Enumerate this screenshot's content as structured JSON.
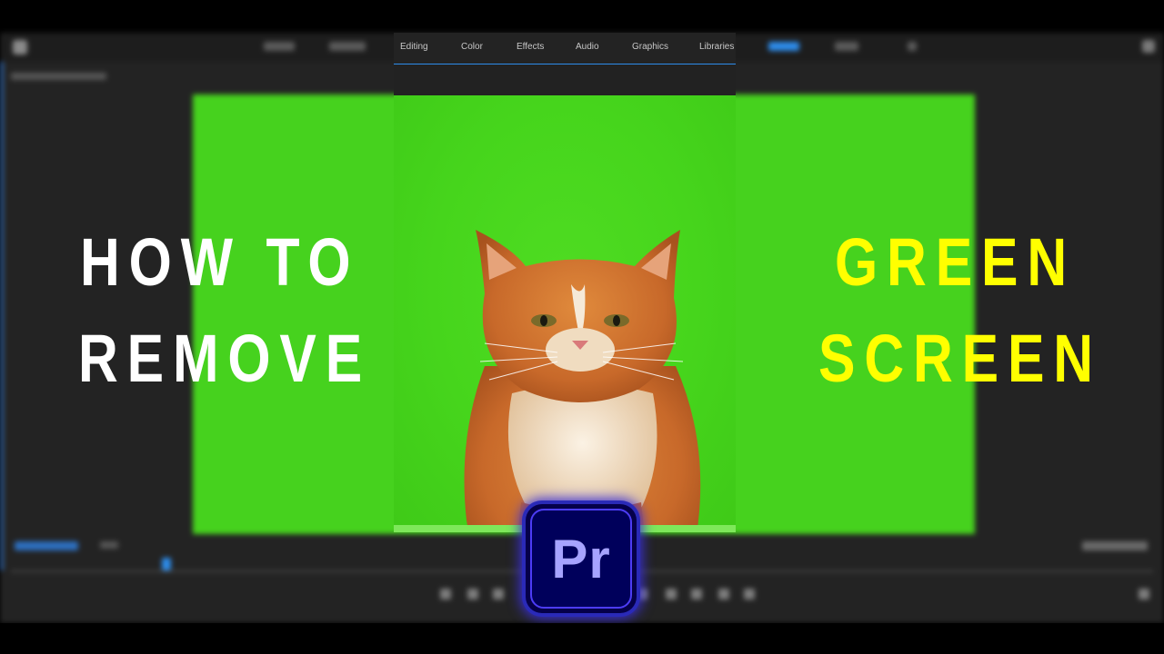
{
  "workspace_tabs": [
    "Editing",
    "Color",
    "Effects",
    "Audio",
    "Graphics",
    "Libraries"
  ],
  "title": {
    "line1": "HOW TO",
    "line2": "REMOVE",
    "line3": "GREEN",
    "line4": "SCREEN"
  },
  "logo": {
    "text": "Pr",
    "name": "Adobe Premiere Pro"
  },
  "colors": {
    "chroma_green": "#46d21e",
    "accent_blue": "#2d8ceb",
    "title_white": "#ffffff",
    "title_yellow": "#ffff00",
    "logo_bg": "#00005b",
    "logo_text": "#a6a3ff"
  }
}
